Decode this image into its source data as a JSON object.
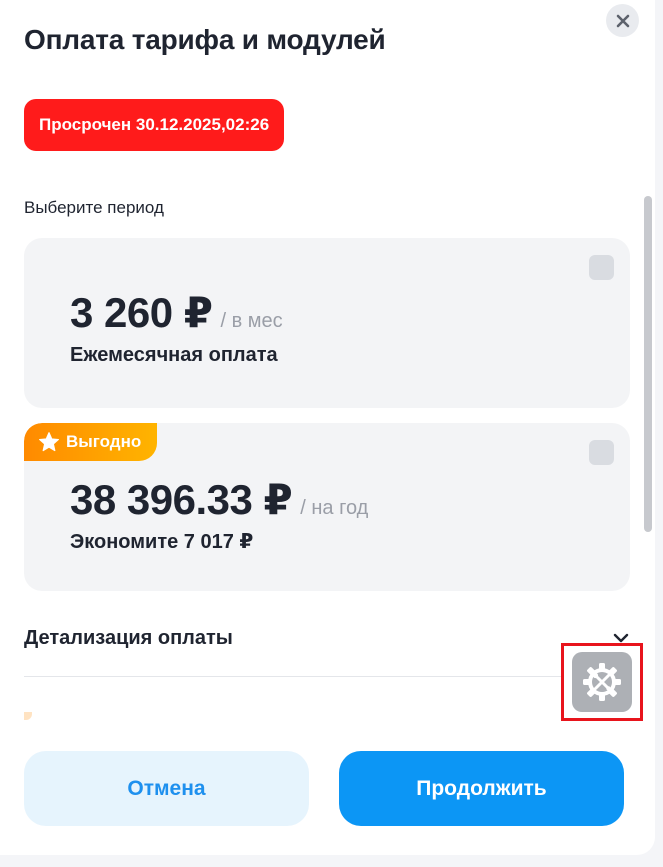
{
  "modal": {
    "title": "Оплата тарифа и модулей",
    "overdue_badge": "Просрочен 30.12.2025,02:26",
    "period_label": "Выберите период"
  },
  "plans": [
    {
      "price": "3 260 ₽",
      "period": "/ в мес",
      "subtitle": "Ежемесячная оплата",
      "selected": false
    },
    {
      "promo": "Выгодно",
      "price": "38 396.33 ₽",
      "period": "/ на год",
      "subtitle": "Экономите 7 017 ₽",
      "selected": false
    }
  ],
  "details": {
    "label": "Детализация оплаты",
    "icon": "chevron-down-icon"
  },
  "actions": {
    "cancel_label": "Отмена",
    "continue_label": "Продолжить"
  },
  "colors": {
    "overdue": "#ff1b1b",
    "primary": "#0c96f5",
    "promo": "#ff9a00",
    "highlight_frame": "#e8141c"
  },
  "icons": {
    "close": "close-icon",
    "star": "star-icon",
    "settings": "gear-tools-icon"
  }
}
